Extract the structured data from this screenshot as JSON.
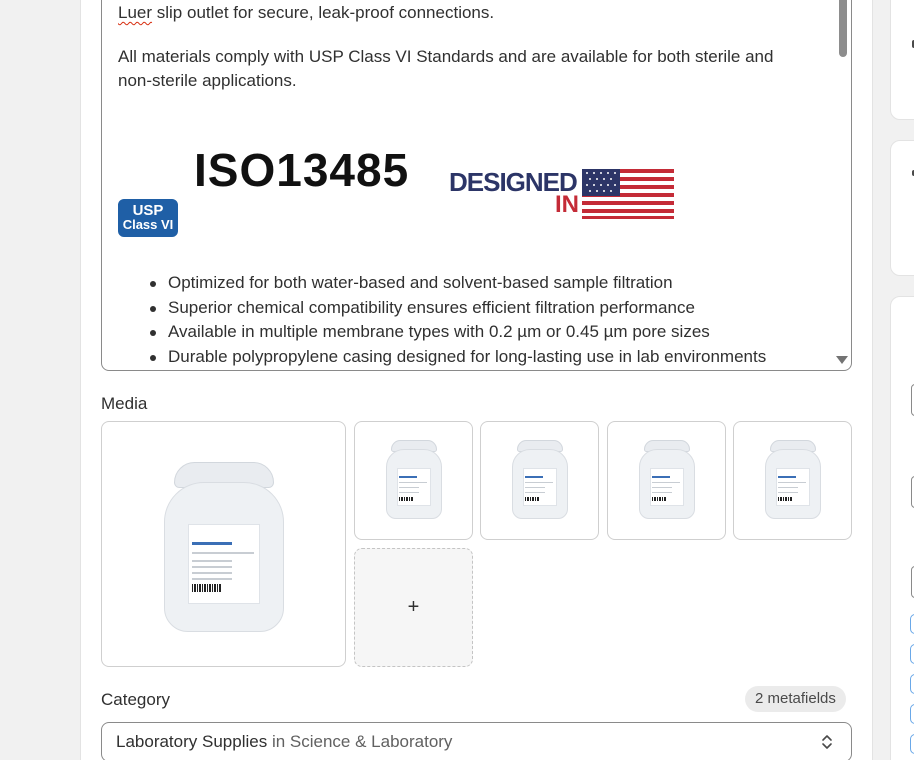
{
  "description": {
    "paragraph1_prefix": "Luer",
    "paragraph1_rest": " slip outlet for secure, leak-proof connections.",
    "paragraph2": "All materials comply with USP Class VI Standards and are available for both sterile and non-sterile applications.",
    "logos": {
      "usp_line1": "USP",
      "usp_line2": "Class VI",
      "iso": "ISO13485",
      "designed": "DESIGNED",
      "in": "IN"
    },
    "bullets": [
      "Optimized for both water-based and solvent-based sample filtration",
      "Superior chemical compatibility ensures efficient filtration performance",
      "Available in multiple membrane types with 0.2 µm or 0.45 µm pore sizes",
      "Durable polypropylene casing designed for long-lasting use in lab environments"
    ]
  },
  "media": {
    "label": "Media",
    "add_symbol": "+",
    "thumbnail_count": 4
  },
  "category": {
    "label": "Category",
    "metafields_badge": "2 metafields",
    "selected_main": "Laboratory Supplies",
    "selected_sub": " in Science & Laboratory"
  },
  "colors": {
    "usp_blue": "#1f5fa6",
    "flag_red": "#c42b37",
    "flag_blue": "#2c3567",
    "spellcheck_red": "#d72c0d"
  }
}
